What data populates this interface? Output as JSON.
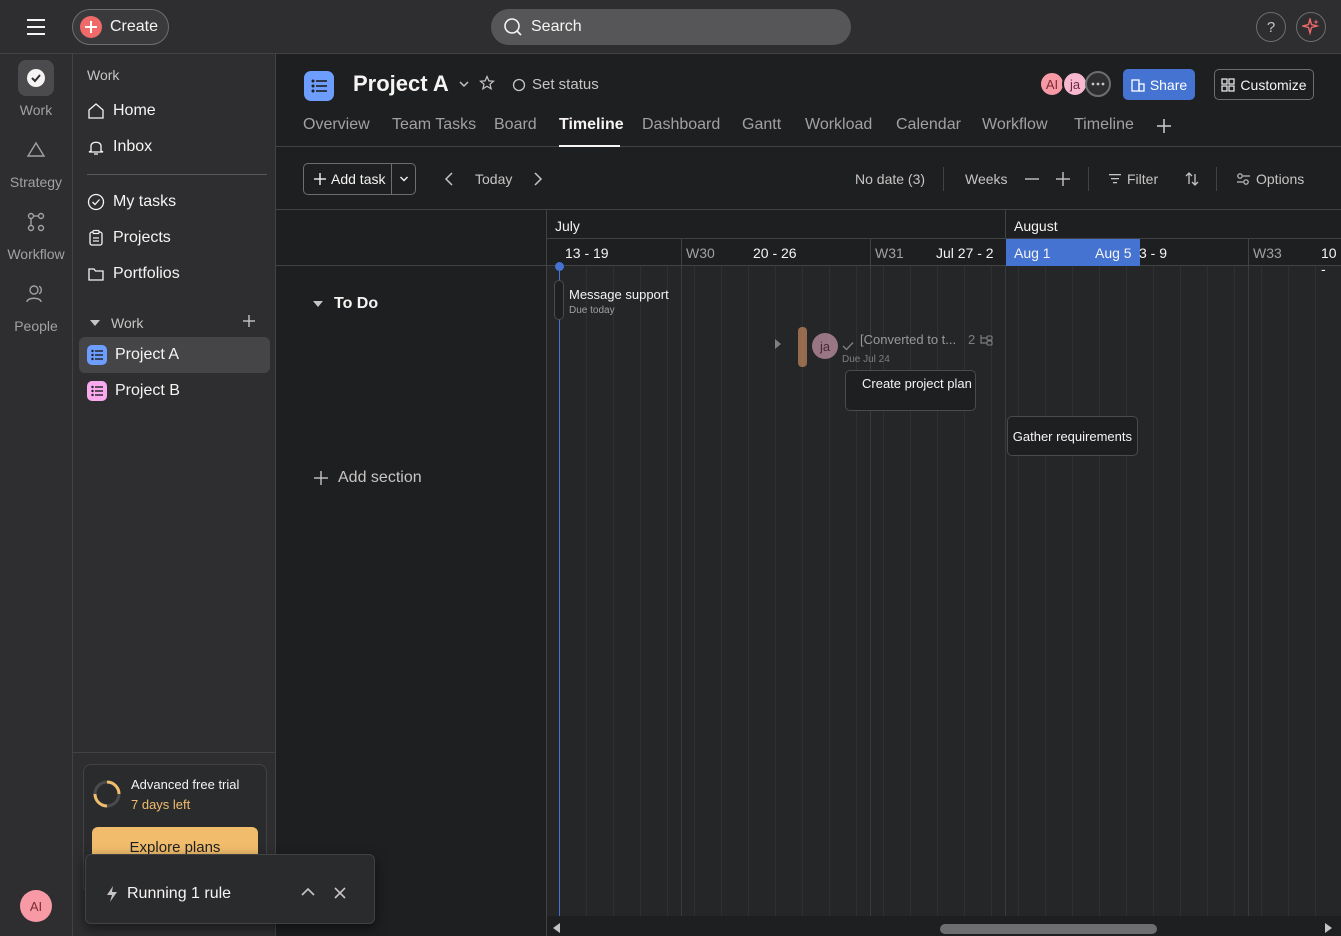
{
  "topbar": {
    "create_label": "Create",
    "search_placeholder": "Search",
    "help_label": "?"
  },
  "rail": {
    "items": [
      {
        "label": "Work",
        "icon": "check-circle-icon"
      },
      {
        "label": "Strategy",
        "icon": "triangle-icon"
      },
      {
        "label": "Workflow",
        "icon": "workflow-icon"
      },
      {
        "label": "People",
        "icon": "people-icon"
      }
    ],
    "user_initials": "AI"
  },
  "sidebar": {
    "heading": "Work",
    "nav": [
      {
        "label": "Home",
        "icon": "home-icon"
      },
      {
        "label": "Inbox",
        "icon": "bell-icon"
      }
    ],
    "nav2": [
      {
        "label": "My tasks",
        "icon": "check-circle-icon"
      },
      {
        "label": "Projects",
        "icon": "clipboard-icon"
      },
      {
        "label": "Portfolios",
        "icon": "folder-icon"
      }
    ],
    "work_section": "Work",
    "projects": [
      {
        "label": "Project A",
        "color": "#6d9eff",
        "active": true
      },
      {
        "label": "Project B",
        "color": "#f9aaef",
        "active": false
      }
    ],
    "trial": {
      "title": "Advanced free trial",
      "days_left": "7 days left",
      "cta": "Explore plans"
    }
  },
  "project": {
    "title": "Project A",
    "set_status": "Set status",
    "members": [
      {
        "initials": "AI",
        "color": "#f79aa6"
      },
      {
        "initials": "ja",
        "color": "#f7b8d0"
      }
    ],
    "share_label": "Share",
    "customize_label": "Customize",
    "tabs": [
      {
        "label": "Overview"
      },
      {
        "label": "Team Tasks"
      },
      {
        "label": "Board"
      },
      {
        "label": "Timeline",
        "active": true
      },
      {
        "label": "Dashboard"
      },
      {
        "label": "Gantt"
      },
      {
        "label": "Workload"
      },
      {
        "label": "Calendar"
      },
      {
        "label": "Workflow"
      },
      {
        "label": "Timeline"
      }
    ]
  },
  "toolbar": {
    "add_task": "Add task",
    "today": "Today",
    "no_date": "No date (3)",
    "zoom": "Weeks",
    "filter": "Filter",
    "options": "Options"
  },
  "tasklist": {
    "section": "To Do",
    "add_section": "Add section"
  },
  "timeline": {
    "months": [
      "July",
      "August"
    ],
    "weeks": [
      "13 - 19",
      "W30",
      "20 - 26",
      "W31",
      "Jul 27 - 2",
      "Aug 1",
      "Aug 5",
      "3 - 9",
      "W33",
      "10 -"
    ],
    "tasks": {
      "message_support": {
        "label": "Message support",
        "due": "Due today"
      },
      "converted": {
        "label": "[Converted to t...",
        "due": "Due Jul 24",
        "subtask_count": "2",
        "assignee": "ja"
      },
      "create_plan": {
        "label": "Create project plan"
      },
      "gather_requirements": {
        "label": "Gather requirements"
      }
    }
  },
  "toast": {
    "label": "Running 1 rule"
  }
}
